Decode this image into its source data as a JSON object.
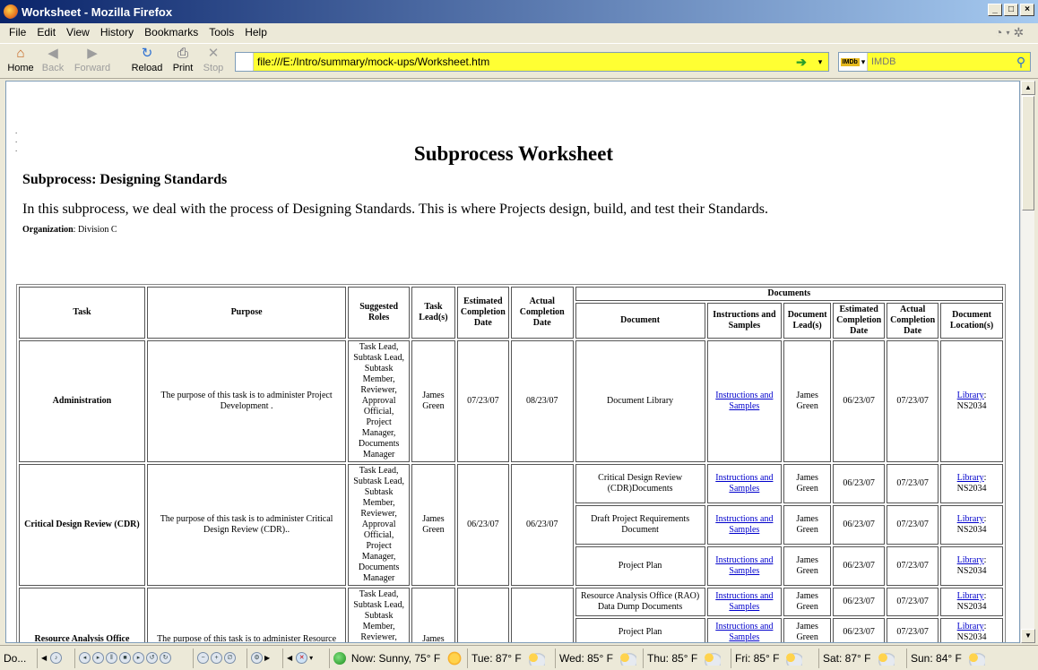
{
  "window": {
    "title": "Worksheet - Mozilla Firefox"
  },
  "menu": [
    "File",
    "Edit",
    "View",
    "History",
    "Bookmarks",
    "Tools",
    "Help"
  ],
  "toolbar": {
    "home": "Home",
    "back": "Back",
    "forward": "Forward",
    "reload": "Reload",
    "print": "Print",
    "stop": "Stop",
    "url": "file:///E:/Intro/summary/mock-ups/Worksheet.htm",
    "search_placeholder": "IMDB",
    "search_engine": "IMDb"
  },
  "page": {
    "title": "Subprocess Worksheet",
    "subprocess_heading": "Subprocess: Designing Standards",
    "intro": "In this subprocess, we deal with the process of Designing Standards. This is where Projects design, build, and test their Standards.",
    "org_label": "Organization",
    "org_value": ": Division C",
    "table": {
      "headers": {
        "task": "Task",
        "purpose": "Purpose",
        "roles": "Suggested Roles",
        "lead": "Task Lead(s)",
        "est": "Estimated Completion Date",
        "actual": "Actual Completion Date",
        "documents": "Documents",
        "document": "Document",
        "instructions": "Instructions and Samples",
        "doc_lead": "Document Lead(s)",
        "doc_est": "Estimated Completion Date",
        "doc_actual": "Actual Completion Date",
        "doc_location": "Document Location(s)"
      },
      "rows": [
        {
          "task": "Administration",
          "purpose": "The purpose of this task is to administer Project Development .",
          "roles": "Task Lead, Subtask Lead, Subtask Member, Reviewer, Approval Official, Project Manager, Documents Manager",
          "lead": "James Green",
          "est": "07/23/07",
          "actual": "08/23/07",
          "docs": [
            {
              "name": "Document Library",
              "instr": "Instructions and Samples",
              "lead": "James Green",
              "est": "06/23/07",
              "actual": "07/23/07",
              "loc_link": "Library",
              "loc_code": ": NS2034"
            }
          ]
        },
        {
          "task": "Critical Design Review (CDR)",
          "purpose": "The purpose of this task is to administer Critical Design Review (CDR)..",
          "roles": "Task Lead, Subtask Lead, Subtask Member, Reviewer, Approval Official, Project Manager, Documents Manager",
          "lead": "James Green",
          "est": "06/23/07",
          "actual": "06/23/07",
          "docs": [
            {
              "name": "Critical Design Review (CDR)Documents",
              "instr": "Instructions and Samples",
              "lead": "James Green",
              "est": "06/23/07",
              "actual": "07/23/07",
              "loc_link": "Library",
              "loc_code": ": NS2034"
            },
            {
              "name": "Draft Project Requirements Document",
              "instr": "Instructions and Samples",
              "lead": "James Green",
              "est": "06/23/07",
              "actual": "07/23/07",
              "loc_link": "Library",
              "loc_code": ": NS2034"
            },
            {
              "name": "Project Plan",
              "instr": "Instructions and Samples",
              "lead": "James Green",
              "est": "06/23/07",
              "actual": "07/23/07",
              "loc_link": "Library",
              "loc_code": ": NS2034"
            }
          ]
        },
        {
          "task": "Resource Analysis Office",
          "purpose": "The purpose of this task is to administer Resource",
          "roles": "Task Lead, Subtask Lead, Subtask Member, Reviewer,",
          "lead": "James",
          "est": "",
          "actual": "",
          "docs": [
            {
              "name": "Resource Analysis Office (RAO) Data Dump Documents",
              "instr": "Instructions and Samples",
              "lead": "James Green",
              "est": "06/23/07",
              "actual": "07/23/07",
              "loc_link": "Library",
              "loc_code": ": NS2034"
            },
            {
              "name": "Project Plan",
              "instr": "Instructions and Samples",
              "lead": "James Green",
              "est": "06/23/07",
              "actual": "07/23/07",
              "loc_link": "Library",
              "loc_code": ": NS2034"
            }
          ]
        }
      ]
    }
  },
  "status": {
    "left": "Do...",
    "now": "Now: Sunny, 75° F",
    "forecast": [
      {
        "label": "Tue: 87° F"
      },
      {
        "label": "Wed: 85° F"
      },
      {
        "label": "Thu: 85° F"
      },
      {
        "label": "Fri: 85° F"
      },
      {
        "label": "Sat: 87° F"
      },
      {
        "label": "Sun: 84° F"
      }
    ]
  }
}
